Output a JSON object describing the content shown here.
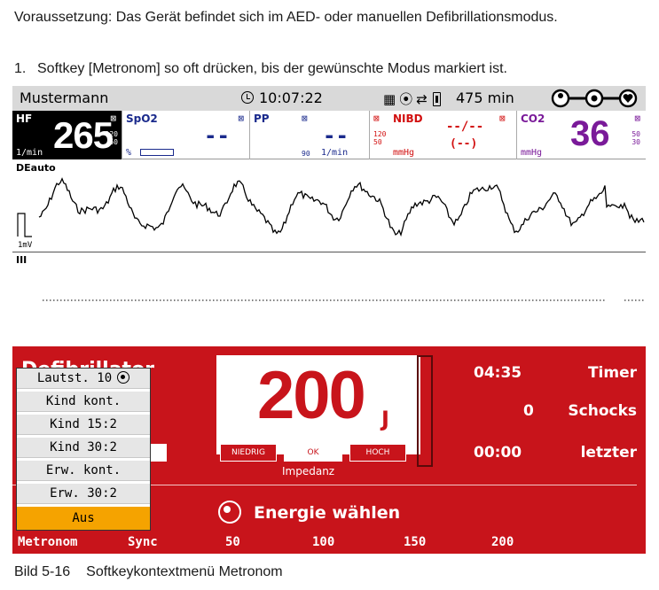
{
  "doc": {
    "intro": "Voraussetzung: Das Gerät befindet sich im AED- oder manuellen Defibrillationsmodus.",
    "step_number": "1.",
    "step_text": "Softkey [Metronom] so oft drücken, bis der gewünschte Modus markiert ist.",
    "caption_number": "Bild 5-16",
    "caption_text": "Softkeykontextmenü Metronom"
  },
  "status": {
    "patient": "Mustermann",
    "time": "10:07:22",
    "runtime": "475 min",
    "icons": [
      "sd-card-icon",
      "wireless-icon",
      "transfer-icon",
      "battery-icon"
    ],
    "mode_icons": [
      "mode-icon-1",
      "mode-icon-2",
      "heart-icon"
    ]
  },
  "params": {
    "hr": {
      "label": "HF",
      "value": "265",
      "unit": "1/min",
      "limit_high": "120",
      "limit_low": "50"
    },
    "spo2": {
      "label": "SpO2",
      "value": "--",
      "unit": "%"
    },
    "pp": {
      "label": "PP",
      "value": "--",
      "unit": "1/min",
      "limit": "90"
    },
    "nibd": {
      "label": "NIBD",
      "value": "--/--",
      "value2": "(--)",
      "unit": "mmHg",
      "limit_high": "120",
      "limit_low": "50"
    },
    "co2": {
      "label": "CO2",
      "value": "36",
      "unit": "mmHg",
      "limit_high": "50",
      "limit_low": "30"
    }
  },
  "ecg": {
    "lead1": "DEauto",
    "scale": "1mV",
    "lead2": "III"
  },
  "defib": {
    "title": "Defibrillator",
    "energy": "200",
    "energy_unit": "J",
    "impedance_low": "NIEDRIG",
    "impedance_ok": "OK",
    "impedance_high": "HOCH",
    "impedance_label": "Impedanz",
    "timer_value": "04:35",
    "timer_label": "Timer",
    "shocks_value": "0",
    "shocks_label": "Schocks",
    "last_value": "00:00",
    "last_label": "letzter",
    "energy_select": "Energie wählen"
  },
  "softkeys": {
    "metronom": "Metronom",
    "sync": "Sync",
    "e50": "50",
    "e100": "100",
    "e150": "150",
    "e200": "200"
  },
  "menu": {
    "items": [
      "Lautst. 10",
      "Kind kont.",
      "Kind 15:2",
      "Kind 30:2",
      "Erw. kont.",
      "Erw. 30:2",
      "Aus"
    ],
    "selected": "Aus"
  },
  "colors": {
    "defib_red": "#c8141b",
    "menu_selected": "#f5a300",
    "spo2_blue": "#1a2a8c",
    "nibd_red": "#d21010",
    "co2_purple": "#7a1a99"
  }
}
